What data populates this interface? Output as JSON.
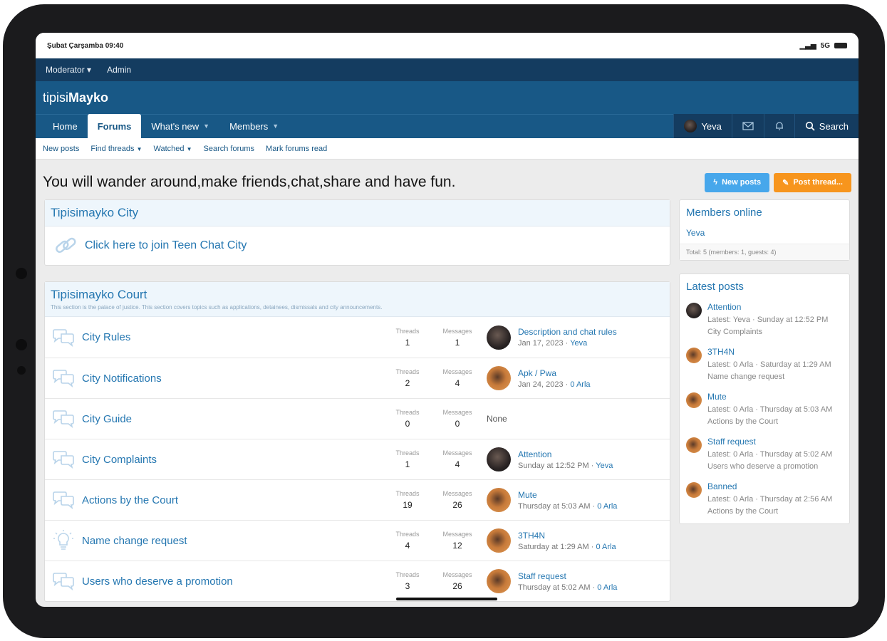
{
  "status_bar": {
    "time": "Şubat Çarşamba 09:40",
    "signal": "5G"
  },
  "mod_bar": {
    "moderator": "Moderator ▾",
    "admin": "Admin"
  },
  "site": {
    "name_light": "tipisi",
    "name_bold": "Mayko"
  },
  "nav": {
    "tabs": [
      "Home",
      "Forums",
      "What's new",
      "Members"
    ],
    "user": "Yeva",
    "search": "Search"
  },
  "subnav": [
    "New posts",
    "Find threads",
    "Watched",
    "Search forums",
    "Mark forums read"
  ],
  "page": {
    "title": "You will wander around,make friends,chat,share and have fun.",
    "new_posts_button": "New posts",
    "post_thread_button": "Post thread..."
  },
  "city_block": {
    "title": "Tipisimayko City",
    "link": "Click here to join Teen Chat City"
  },
  "court_block": {
    "title": "Tipisimayko Court",
    "description": "This section is the palace of justice. This section covers topics such as applications, detainees, dismissals and city announcements.",
    "threads_label": "Threads",
    "messages_label": "Messages",
    "forums": [
      {
        "name": "City Rules",
        "threads": "1",
        "messages": "1",
        "avatar": "dark",
        "latest_title": "Description and chat rules",
        "latest_date": "Jan 17, 2023 · ",
        "latest_user": "Yeva"
      },
      {
        "name": "City Notifications",
        "threads": "2",
        "messages": "4",
        "avatar": "orange",
        "latest_title": "Apk / Pwa",
        "latest_date": "Jan 24, 2023 · ",
        "latest_user": "0 Arla"
      },
      {
        "name": "City Guide",
        "threads": "0",
        "messages": "0",
        "avatar": "none",
        "latest_title": "None",
        "latest_date": "",
        "latest_user": ""
      },
      {
        "name": "City Complaints",
        "threads": "1",
        "messages": "4",
        "avatar": "dark",
        "latest_title": "Attention",
        "latest_date": "Sunday at 12:52 PM · ",
        "latest_user": "Yeva"
      },
      {
        "name": "Actions by the Court",
        "threads": "19",
        "messages": "26",
        "avatar": "orange",
        "latest_title": "Mute",
        "latest_date": "Thursday at 5:03 AM · ",
        "latest_user": "0 Arla"
      },
      {
        "name": "Name change request",
        "threads": "4",
        "messages": "12",
        "avatar": "orange",
        "latest_title": "3TH4N",
        "latest_date": "Saturday at 1:29 AM · ",
        "latest_user": "0 Arla"
      },
      {
        "name": "Users who deserve a promotion",
        "threads": "3",
        "messages": "26",
        "avatar": "orange",
        "latest_title": "Staff request",
        "latest_date": "Thursday at 5:02 AM · ",
        "latest_user": "0 Arla"
      }
    ]
  },
  "members_online": {
    "title": "Members online",
    "user": "Yeva",
    "total": "Total: 5 (members: 1, guests: 4)"
  },
  "latest_posts": {
    "title": "Latest posts",
    "items": [
      {
        "title": "Attention",
        "meta": "Latest: Yeva · Sunday at 12:52 PM",
        "forum": "City Complaints",
        "avatar": "dark"
      },
      {
        "title": "3TH4N",
        "meta": "Latest: 0 Arla · Saturday at 1:29 AM",
        "forum": "Name change request",
        "avatar": "orange"
      },
      {
        "title": "Mute",
        "meta": "Latest: 0 Arla · Thursday at 5:03 AM",
        "forum": "Actions by the Court",
        "avatar": "orange"
      },
      {
        "title": "Staff request",
        "meta": "Latest: 0 Arla · Thursday at 5:02 AM",
        "forum": "Users who deserve a promotion",
        "avatar": "orange"
      },
      {
        "title": "Banned",
        "meta": "Latest: 0 Arla · Thursday at 2:56 AM",
        "forum": "Actions by the Court",
        "avatar": "orange"
      }
    ]
  },
  "colors": {
    "header": "#185886",
    "mod_bar": "#143c60",
    "link": "#2577b1",
    "orange_button": "#f7951d",
    "blue_button": "#47a7eb"
  }
}
